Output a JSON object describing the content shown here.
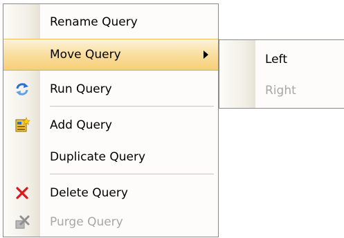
{
  "context_menu": {
    "items": [
      {
        "label": "Rename Query",
        "icon": "none"
      },
      {
        "label": "Move Query",
        "icon": "none",
        "has_submenu": true
      },
      {
        "label": "Run Query",
        "icon": "refresh-icon"
      },
      {
        "label": "Add Query",
        "icon": "add-query-icon"
      },
      {
        "label": "Duplicate Query",
        "icon": "none"
      },
      {
        "label": "Delete Query",
        "icon": "delete-x-icon"
      },
      {
        "label": "Purge Query",
        "icon": "purge-icon",
        "disabled": true
      }
    ]
  },
  "submenu": {
    "items": [
      {
        "label": "Left"
      },
      {
        "label": "Right",
        "disabled": true
      }
    ]
  },
  "colors": {
    "hover_top": "#fdf3d8",
    "hover_bottom": "#f6cf7a",
    "disabled_text": "#a7a7a7",
    "delete_red": "#d81a1a",
    "refresh_blue": "#2b6fd1"
  }
}
